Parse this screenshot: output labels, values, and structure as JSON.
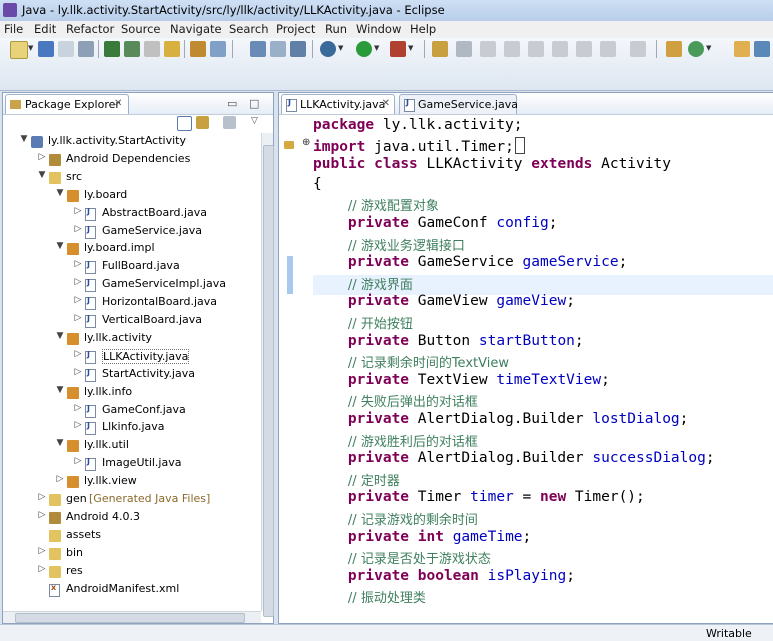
{
  "window": {
    "title": "Java - ly.llk.activity.StartActivity/src/ly/llk/activity/LLKActivity.java - Eclipse"
  },
  "menu": [
    "File",
    "Edit",
    "Refactor",
    "Source",
    "Navigate",
    "Search",
    "Project",
    "Run",
    "Window",
    "Help"
  ],
  "package_explorer": {
    "title": "Package Explorer",
    "close": "✕",
    "tree": [
      {
        "label": "ly.llk.activity.StartActivity",
        "icon": "project-icon",
        "twisty": "▼"
      },
      {
        "label": "Android Dependencies",
        "icon": "library-icon",
        "twisty": "▷"
      },
      {
        "label": "src",
        "icon": "source-folder-icon",
        "twisty": "▼"
      },
      {
        "label": "ly.board",
        "icon": "package-icon",
        "twisty": "▼"
      },
      {
        "label": "AbstractBoard.java",
        "icon": "java-file-icon",
        "twisty": "▷"
      },
      {
        "label": "GameService.java",
        "icon": "java-file-icon",
        "twisty": "▷"
      },
      {
        "label": "ly.board.impl",
        "icon": "package-icon",
        "twisty": "▼"
      },
      {
        "label": "FullBoard.java",
        "icon": "java-file-icon",
        "twisty": "▷"
      },
      {
        "label": "GameServiceImpl.java",
        "icon": "java-file-icon",
        "twisty": "▷"
      },
      {
        "label": "HorizontalBoard.java",
        "icon": "java-file-icon",
        "twisty": "▷"
      },
      {
        "label": "VerticalBoard.java",
        "icon": "java-file-icon",
        "twisty": "▷"
      },
      {
        "label": "ly.llk.activity",
        "icon": "package-icon",
        "twisty": "▼"
      },
      {
        "label": "LLKActivity.java",
        "icon": "java-file-icon",
        "twisty": "▷"
      },
      {
        "label": "StartActivity.java",
        "icon": "java-file-icon",
        "twisty": "▷"
      },
      {
        "label": "ly.llk.info",
        "icon": "package-icon",
        "twisty": "▼"
      },
      {
        "label": "GameConf.java",
        "icon": "java-file-icon",
        "twisty": "▷"
      },
      {
        "label": "Llkinfo.java",
        "icon": "java-file-icon",
        "twisty": "▷"
      },
      {
        "label": "ly.llk.util",
        "icon": "package-icon",
        "twisty": "▼"
      },
      {
        "label": "ImageUtil.java",
        "icon": "java-file-icon",
        "twisty": "▷"
      },
      {
        "label": "ly.llk.view",
        "icon": "package-icon",
        "twisty": "▷"
      },
      {
        "label": "gen",
        "suffix": "[Generated Java Files]",
        "icon": "folder-icon",
        "twisty": "▷"
      },
      {
        "label": "Android 4.0.3",
        "icon": "library-icon",
        "twisty": "▷"
      },
      {
        "label": "assets",
        "icon": "folder-icon",
        "twisty": ""
      },
      {
        "label": "bin",
        "icon": "folder-icon",
        "twisty": "▷"
      },
      {
        "label": "res",
        "icon": "folder-icon",
        "twisty": "▷"
      },
      {
        "label": "AndroidManifest.xml",
        "icon": "xml-file-icon",
        "twisty": ""
      }
    ]
  },
  "editor": {
    "tabs": [
      {
        "label": "LLKActivity.java",
        "close": "✕",
        "active": true
      },
      {
        "label": "GameService.java",
        "active": false
      }
    ],
    "lines": [
      [
        {
          "t": "package",
          "c": "kw"
        },
        {
          "t": " ly.llk.activity;",
          "c": ""
        }
      ],
      [
        {
          "t": "import",
          "c": "kw"
        },
        {
          "t": " java.util.Timer;",
          "c": ""
        }
      ],
      [
        {
          "t": "public",
          "c": "kw"
        },
        {
          "t": " ",
          "c": ""
        },
        {
          "t": "class",
          "c": "kw"
        },
        {
          "t": " LLKActivity ",
          "c": ""
        },
        {
          "t": "extends",
          "c": "kw"
        },
        {
          "t": " Activity",
          "c": ""
        }
      ],
      [
        {
          "t": "{",
          "c": ""
        }
      ],
      [
        {
          "t": "    ",
          "c": ""
        },
        {
          "t": "// 游戏配置对象",
          "c": "cm"
        }
      ],
      [
        {
          "t": "    ",
          "c": ""
        },
        {
          "t": "private",
          "c": "kw"
        },
        {
          "t": " GameConf ",
          "c": ""
        },
        {
          "t": "config",
          "c": "fd"
        },
        {
          "t": ";",
          "c": ""
        }
      ],
      [
        {
          "t": "    ",
          "c": ""
        },
        {
          "t": "// 游戏业务逻辑接口",
          "c": "cm"
        }
      ],
      [
        {
          "t": "    ",
          "c": ""
        },
        {
          "t": "private",
          "c": "kw"
        },
        {
          "t": " GameService ",
          "c": ""
        },
        {
          "t": "gameService",
          "c": "fd"
        },
        {
          "t": ";",
          "c": ""
        }
      ],
      [
        {
          "t": "    ",
          "c": ""
        },
        {
          "t": "// 游戏界面",
          "c": "cm"
        }
      ],
      [
        {
          "t": "    ",
          "c": ""
        },
        {
          "t": "private",
          "c": "kw"
        },
        {
          "t": " GameView ",
          "c": ""
        },
        {
          "t": "gameView",
          "c": "fd"
        },
        {
          "t": ";",
          "c": ""
        }
      ],
      [
        {
          "t": "    ",
          "c": ""
        },
        {
          "t": "// 开始按钮",
          "c": "cm"
        }
      ],
      [
        {
          "t": "    ",
          "c": ""
        },
        {
          "t": "private",
          "c": "kw"
        },
        {
          "t": " Button ",
          "c": ""
        },
        {
          "t": "startButton",
          "c": "fd"
        },
        {
          "t": ";",
          "c": ""
        }
      ],
      [
        {
          "t": "    ",
          "c": ""
        },
        {
          "t": "// 记录剩余时间的TextView",
          "c": "cm"
        }
      ],
      [
        {
          "t": "    ",
          "c": ""
        },
        {
          "t": "private",
          "c": "kw"
        },
        {
          "t": " TextView ",
          "c": ""
        },
        {
          "t": "timeTextView",
          "c": "fd"
        },
        {
          "t": ";",
          "c": ""
        }
      ],
      [
        {
          "t": "    ",
          "c": ""
        },
        {
          "t": "// 失败后弹出的对话框",
          "c": "cm"
        }
      ],
      [
        {
          "t": "    ",
          "c": ""
        },
        {
          "t": "private",
          "c": "kw"
        },
        {
          "t": " AlertDialog.Builder ",
          "c": ""
        },
        {
          "t": "lostDialog",
          "c": "fd"
        },
        {
          "t": ";",
          "c": ""
        }
      ],
      [
        {
          "t": "    ",
          "c": ""
        },
        {
          "t": "// 游戏胜利后的对话框",
          "c": "cm"
        }
      ],
      [
        {
          "t": "    ",
          "c": ""
        },
        {
          "t": "private",
          "c": "kw"
        },
        {
          "t": " AlertDialog.Builder ",
          "c": ""
        },
        {
          "t": "successDialog",
          "c": "fd"
        },
        {
          "t": ";",
          "c": ""
        }
      ],
      [
        {
          "t": "    ",
          "c": ""
        },
        {
          "t": "// 定时器",
          "c": "cm"
        }
      ],
      [
        {
          "t": "    ",
          "c": ""
        },
        {
          "t": "private",
          "c": "kw"
        },
        {
          "t": " Timer ",
          "c": ""
        },
        {
          "t": "timer",
          "c": "fd"
        },
        {
          "t": " = ",
          "c": ""
        },
        {
          "t": "new",
          "c": "kw"
        },
        {
          "t": " Timer();",
          "c": ""
        }
      ],
      [
        {
          "t": "    ",
          "c": ""
        },
        {
          "t": "// 记录游戏的剩余时间",
          "c": "cm"
        }
      ],
      [
        {
          "t": "    ",
          "c": ""
        },
        {
          "t": "private",
          "c": "kw"
        },
        {
          "t": " ",
          "c": ""
        },
        {
          "t": "int",
          "c": "kw"
        },
        {
          "t": " ",
          "c": ""
        },
        {
          "t": "gameTime",
          "c": "fd"
        },
        {
          "t": ";",
          "c": ""
        }
      ],
      [
        {
          "t": "    ",
          "c": ""
        },
        {
          "t": "// 记录是否处于游戏状态",
          "c": "cm"
        }
      ],
      [
        {
          "t": "    ",
          "c": ""
        },
        {
          "t": "private",
          "c": "kw"
        },
        {
          "t": " ",
          "c": ""
        },
        {
          "t": "boolean",
          "c": "kw"
        },
        {
          "t": " ",
          "c": ""
        },
        {
          "t": "isPlaying",
          "c": "fd"
        },
        {
          "t": ";",
          "c": ""
        }
      ],
      [
        {
          "t": "    ",
          "c": ""
        },
        {
          "t": "// 振动处理类",
          "c": "cm"
        }
      ]
    ]
  },
  "status": {
    "mode": "Writable"
  },
  "colors": {
    "keyword": "#7f0055",
    "field": "#0000c0",
    "comment": "#3f7f5f",
    "current_line": "#e8f2fe"
  }
}
